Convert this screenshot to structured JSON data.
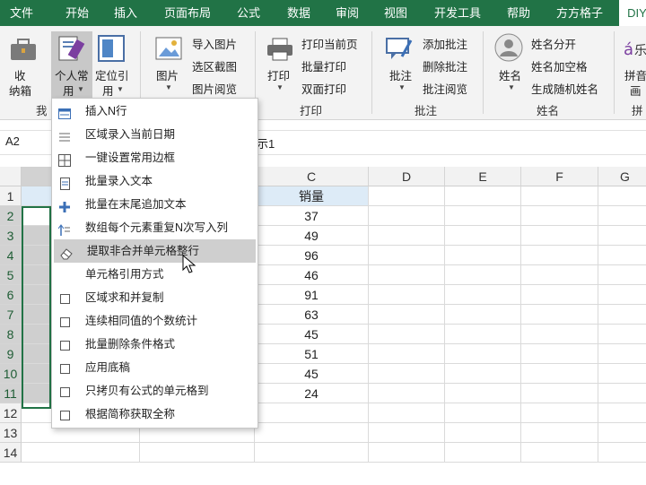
{
  "menu_tabs": [
    "文件",
    "开始",
    "插入",
    "页面布局",
    "公式",
    "数据",
    "审阅",
    "视图",
    "开发工具",
    "帮助",
    "方方格子",
    "DIY"
  ],
  "ribbon": {
    "tool_label": "收\n纳箱",
    "tool_label_a": "收",
    "tool_label_b": "纳箱",
    "personal": "个人常",
    "personal_b": "用",
    "locate": "定位引",
    "locate_b": "用",
    "picture": "图片",
    "insert_picture": "导入图片",
    "select_screenshot": "选区截图",
    "picture_view": "图片阅览",
    "group_picture": "",
    "print": "打印",
    "print_current": "打印当前页",
    "batch_print": "批量打印",
    "duplex_print": "双面打印",
    "group_print": "打印",
    "comment": "批注",
    "add_comment": "添加批注",
    "delete_comment": "删除批注",
    "comment_view": "批注阅览",
    "group_comment": "批注",
    "name": "姓名",
    "name_split": "姓名分开",
    "name_space": "姓名加空格",
    "random_name": "生成随机姓名",
    "group_name": "姓名",
    "pinyin": "拼音",
    "pinyin_b": "画",
    "group_pinyin": "拼",
    "group_my": "我"
  },
  "formula_bar": {
    "cell_ref": "A2",
    "content": "示1"
  },
  "columns": [
    "C",
    "D",
    "E",
    "F",
    "G"
  ],
  "rows": [
    "1",
    "2",
    "3",
    "4",
    "5",
    "6",
    "7",
    "8",
    "9",
    "10",
    "11",
    "12",
    "13",
    "14"
  ],
  "sales_header": "销量",
  "sales_values": [
    "37",
    "49",
    "96",
    "46",
    "91",
    "63",
    "45",
    "51",
    "45",
    "24"
  ],
  "dropdown_items": [
    {
      "label": "插入N行",
      "icon": "insert-rows-icon"
    },
    {
      "label": "区域录入当前日期",
      "icon": "date-list-icon"
    },
    {
      "label": "一键设置常用边框",
      "icon": "border-icon"
    },
    {
      "label": "批量录入文本",
      "icon": "text-doc-icon"
    },
    {
      "label": "批量在末尾追加文本",
      "icon": "plus-icon"
    },
    {
      "label": "数组每个元素重复N次写入列",
      "icon": "repeat-icon"
    },
    {
      "label": "提取非合并单元格整行",
      "icon": "eraser-icon"
    },
    {
      "label": "单元格引用方式",
      "icon": ""
    },
    {
      "label": "区域求和并复制",
      "icon": "checkbox-icon"
    },
    {
      "label": "连续相同值的个数统计",
      "icon": "checkbox-icon"
    },
    {
      "label": "批量删除条件格式",
      "icon": "checkbox-icon"
    },
    {
      "label": "应用底稿",
      "icon": "checkbox-icon"
    },
    {
      "label": "只拷贝有公式的单元格到",
      "icon": "checkbox-icon"
    },
    {
      "label": "根据简称获取全称",
      "icon": "checkbox-icon"
    }
  ],
  "highlighted_index": 6,
  "colors": {
    "excel_green": "#217346",
    "header_blue": "#ddebf7"
  }
}
